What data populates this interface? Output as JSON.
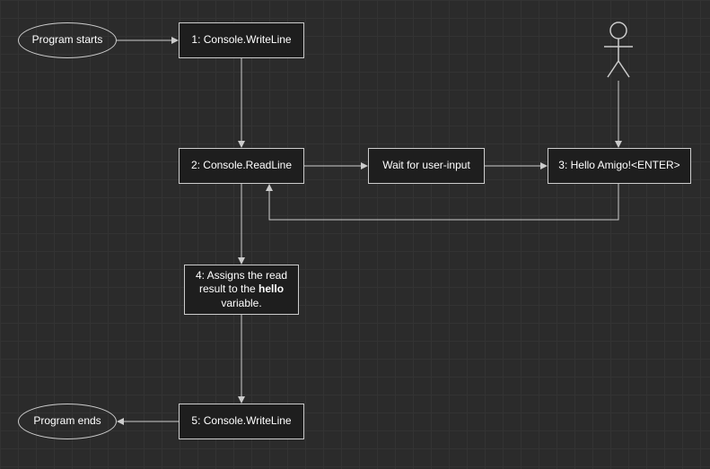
{
  "nodes": {
    "start": {
      "label": "Program starts"
    },
    "step1": {
      "label": "1: Console.WriteLine"
    },
    "step2": {
      "label": "2: Console.ReadLine"
    },
    "wait": {
      "label": "Wait for user-input"
    },
    "step3": {
      "label": "3: Hello Amigo!<ENTER>"
    },
    "step4_prefix": "4: Assigns the read result to the ",
    "step4_bold": "hello",
    "step4_suffix": " variable.",
    "step5": {
      "label": "5: Console.WriteLine"
    },
    "end": {
      "label": "Program ends"
    }
  }
}
